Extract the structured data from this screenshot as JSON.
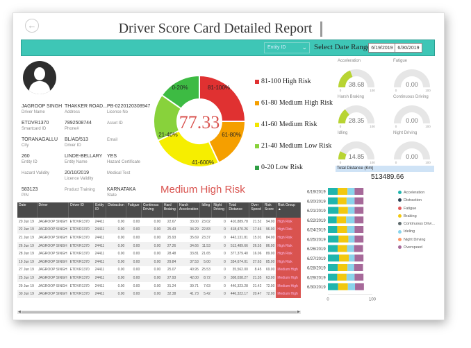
{
  "header": {
    "title": "Driver Score Card Detailed Report",
    "back_icon": "back-arrow-icon"
  },
  "filters": {
    "entity_placeholder": "Entity ID",
    "date_label": "Select Date Range",
    "date_from": "6/19/2019",
    "date_to": "6/30/2019"
  },
  "driver": {
    "name": "JAGROOP SINGH",
    "name_label": "Driver Name",
    "address": "THAKKER ROAD...",
    "address_label": "Address",
    "licence_no": "PB-0220120308947",
    "licence_no_label": "Licence No",
    "smartcard_id": "ETDVR1370",
    "smartcard_label": "Smartcard ID",
    "phone": "7892508744",
    "phone_label": "Phone#",
    "asset_id_label": "Asset ID",
    "city": "TORANAGALLU",
    "city_label": "City",
    "driver_id": "BL/AD/513",
    "driver_id_label": "Driver ID",
    "email_label": "Email",
    "entity_id": "260",
    "entity_id_label": "Entity ID",
    "entity_name": "LINDE-BELLARY",
    "entity_name_label": "Entity Name",
    "hazard_cert": "YES",
    "hazard_cert_label": "Hazard Certificate",
    "hazard_validity_label": "Hazard Validity",
    "licence_validity": "20/10/2019",
    "licence_validity_label": "Licence Validity",
    "medical_label": "Medical Test",
    "pin": "583123",
    "pin_label": "PIN",
    "training_label": "Product Training",
    "state": "KARNATAKA",
    "state_label": "State"
  },
  "score": {
    "value": "77.33",
    "risk_group": "Medium High Risk",
    "segments": [
      {
        "label": "81-100%",
        "color": "#e03131"
      },
      {
        "label": "61-80%",
        "color": "#f59f00"
      },
      {
        "label": "41-600%",
        "color": "#f6ee00"
      },
      {
        "label": "21-40%",
        "color": "#88d23b"
      },
      {
        "label": "0-20%",
        "color": "#3dbb43"
      }
    ],
    "legend": [
      {
        "label": "81-100 High Risk",
        "color": "#e03131"
      },
      {
        "label": "61-80 Medium High Risk",
        "color": "#f59f00"
      },
      {
        "label": "41-60 Medium Risk",
        "color": "#f2e600"
      },
      {
        "label": "21-40 Medium Low Risk",
        "color": "#88d23b"
      },
      {
        "label": "0-20 Low Risk",
        "color": "#2f9e44"
      }
    ]
  },
  "gauges": [
    {
      "name": "Acceleration",
      "value": "38.68",
      "fraction": 0.3868,
      "min": "0",
      "max": "100"
    },
    {
      "name": "Fatigue",
      "value": "0.00",
      "fraction": 0,
      "min": "0",
      "max": "100"
    },
    {
      "name": "Harsh Braking",
      "value": "28.35",
      "fraction": 0.2835,
      "min": "0",
      "max": "100"
    },
    {
      "name": "Continuous Driving",
      "value": "0.00",
      "fraction": 0,
      "min": "0",
      "max": "100"
    },
    {
      "name": "Idling",
      "value": "14.85",
      "fraction": 0.1485,
      "min": "0",
      "max": "100"
    },
    {
      "name": "Night Driving",
      "value": "0.00",
      "fraction": 0,
      "min": "0",
      "max": "100"
    }
  ],
  "distance": {
    "label": "Total Distance (Km)",
    "value": "513489.66"
  },
  "table": {
    "headers": [
      "Date",
      "Driver",
      "Driver ID",
      "Entity ID",
      "Distraction",
      "Fatigue",
      "Continous Driving",
      "Hard Braking",
      "Harsh Acceleration",
      "Idling",
      "Night Driving",
      "Total Distance",
      "Over Speed",
      "Risk Score",
      "Risk Group"
    ],
    "rows": [
      [
        "20 Jun 19",
        "JAGROOP SINGH",
        "ETDVR1370",
        "24411",
        "0.00",
        "0.00",
        "0.00",
        "22.67",
        "33.00",
        "23.02",
        "0",
        "410,889.78",
        "21.52",
        "94.00",
        "High Risk"
      ],
      [
        "22 Jun 19",
        "JAGROOP SINGH",
        "ETDVR1370",
        "24411",
        "0.00",
        "0.00",
        "0.00",
        "25.43",
        "34.29",
        "22.83",
        "0",
        "418,470.26",
        "17.46",
        "96.00",
        "High Risk"
      ],
      [
        "21 Jun 19",
        "JAGROOP SINGH",
        "ETDVR1370",
        "24411",
        "0.00",
        "0.00",
        "0.00",
        "25.93",
        "35.69",
        "23.37",
        "0",
        "443,131.81",
        "15.01",
        "84.00",
        "High Risk"
      ],
      [
        "26 Jun 19",
        "JAGROOP SINGH",
        "ETDVR1370",
        "24411",
        "0.00",
        "0.00",
        "0.00",
        "27.26",
        "34.66",
        "11.53",
        "0",
        "513,489.66",
        "26.55",
        "86.00",
        "High Risk"
      ],
      [
        "28 Jun 19",
        "JAGROOP SINGH",
        "ETDVR1370",
        "24411",
        "0.00",
        "0.00",
        "0.00",
        "28.48",
        "33.81",
        "21.65",
        "0",
        "377,379.40",
        "16.06",
        "89.00",
        "High Risk"
      ],
      [
        "19 Jun 19",
        "JAGROOP SINGH",
        "ETDVR1370",
        "24411",
        "0.00",
        "0.00",
        "0.00",
        "29.84",
        "37.53",
        "5.00",
        "0",
        "334,674.01",
        "27.63",
        "85.00",
        "High Risk"
      ],
      [
        "27 Jun 19",
        "JAGROOP SINGH",
        "ETDVR1370",
        "24411",
        "0.00",
        "0.00",
        "0.00",
        "25.07",
        "40.95",
        "25.53",
        "0",
        "35,562.00",
        "8.45",
        "69.00",
        "Medium High"
      ],
      [
        "25 Jun 19",
        "JAGROOP SINGH",
        "ETDVR1370",
        "24411",
        "0.00",
        "0.00",
        "0.00",
        "27.93",
        "42.00",
        "8.72",
        "0",
        "308,038.27",
        "21.35",
        "63.00",
        "Medium High"
      ],
      [
        "29 Jun 19",
        "JAGROOP SINGH",
        "ETDVR1370",
        "24411",
        "0.00",
        "0.00",
        "0.00",
        "31.24",
        "39.71",
        "7.63",
        "0",
        "446,323.28",
        "21.42",
        "72.00",
        "Medium High"
      ],
      [
        "30 Jun 19",
        "JAGROOP SINGH",
        "ETDVR1370",
        "24411",
        "0.00",
        "0.00",
        "0.00",
        "32.38",
        "41.73",
        "5.42",
        "0",
        "446,322.17",
        "20.47",
        "72.00",
        "Medium High"
      ]
    ]
  },
  "chart_data": {
    "type": "bar",
    "orientation": "horizontal",
    "stacked": true,
    "categories": [
      "6/19/2019",
      "6/20/2019",
      "6/21/2019",
      "6/22/2019",
      "6/24/2019",
      "6/25/2019",
      "6/26/2019",
      "6/27/2019",
      "6/28/2019",
      "6/29/2019",
      "6/30/2019"
    ],
    "xlim": [
      0,
      100
    ],
    "xticks": [
      "0",
      "100"
    ],
    "series": [
      {
        "name": "Acceleration",
        "color": "#1fb5ad",
        "values": [
          22,
          22,
          24,
          20,
          21,
          24,
          22,
          25,
          22,
          21,
          23
        ]
      },
      {
        "name": "Distraction",
        "color": "#2c3e50",
        "values": [
          0,
          0,
          0,
          0,
          0,
          0,
          0,
          0,
          0,
          0,
          0
        ]
      },
      {
        "name": "Fatigue",
        "color": "#e15759",
        "values": [
          0,
          0,
          0,
          0,
          0,
          0,
          0,
          0,
          0,
          0,
          0
        ]
      },
      {
        "name": "Braking",
        "color": "#f2c80f",
        "values": [
          22,
          20,
          21,
          21,
          22,
          22,
          21,
          22,
          22,
          21,
          22
        ]
      },
      {
        "name": "Continuous Drivi...",
        "color": "#5f6b6d",
        "values": [
          0,
          0,
          0,
          0,
          0,
          0,
          0,
          0,
          0,
          0,
          0
        ]
      },
      {
        "name": "Ideling",
        "color": "#8ad4eb",
        "values": [
          16,
          18,
          15,
          19,
          17,
          14,
          16,
          13,
          15,
          18,
          16
        ]
      },
      {
        "name": "Night Driving",
        "color": "#fe9666",
        "values": [
          0,
          0,
          0,
          0,
          0,
          0,
          0,
          0,
          0,
          0,
          0
        ]
      },
      {
        "name": "Overspeed",
        "color": "#a66999",
        "values": [
          20,
          20,
          20,
          20,
          20,
          20,
          20,
          20,
          20,
          20,
          20
        ]
      }
    ]
  }
}
